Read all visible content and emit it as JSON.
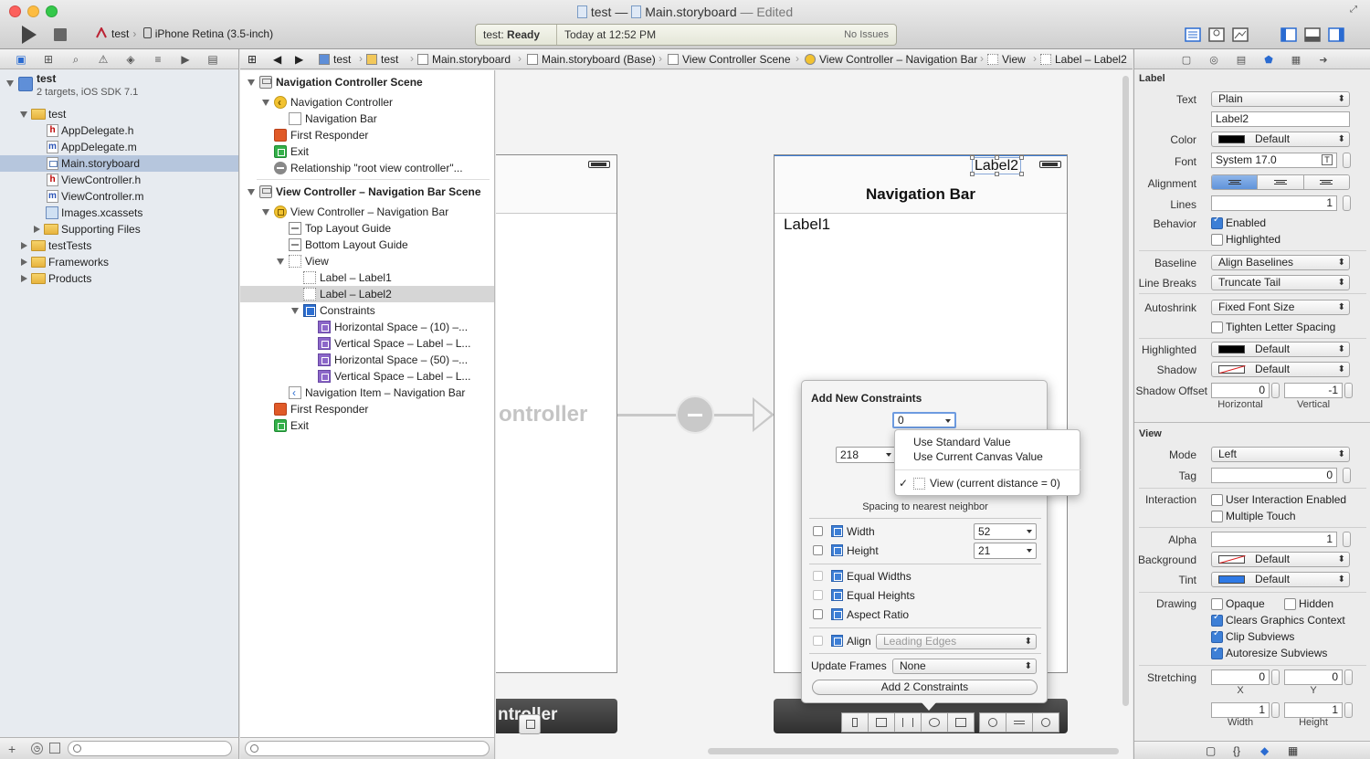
{
  "window": {
    "title_file": "test",
    "title_sep": "—",
    "title_doc": "Main.storyboard",
    "title_edited": "— Edited"
  },
  "toolbar": {
    "scheme": "test",
    "device": "iPhone Retina (3.5-inch)",
    "status_name": "test:",
    "status_state": "Ready",
    "status_time": "Today at 12:52 PM",
    "issues": "No Issues"
  },
  "navigator": {
    "project": {
      "name": "test",
      "subtitle": "2 targets, iOS SDK 7.1"
    },
    "items": [
      {
        "label": "test"
      },
      {
        "label": "AppDelegate.h"
      },
      {
        "label": "AppDelegate.m"
      },
      {
        "label": "Main.storyboard"
      },
      {
        "label": "ViewController.h"
      },
      {
        "label": "ViewController.m"
      },
      {
        "label": "Images.xcassets"
      },
      {
        "label": "Supporting Files"
      },
      {
        "label": "testTests"
      },
      {
        "label": "Frameworks"
      },
      {
        "label": "Products"
      }
    ]
  },
  "jumpbar": {
    "crumbs": [
      "test",
      "test",
      "Main.storyboard",
      "Main.storyboard (Base)",
      "View Controller Scene",
      "View Controller – Navigation Bar",
      "View",
      "Label – Label2"
    ]
  },
  "outline": {
    "rows": [
      "Navigation Controller Scene",
      "Navigation Controller",
      "Navigation Bar",
      "First Responder",
      "Exit",
      "Relationship \"root view controller\"...",
      "View Controller – Navigation Bar Scene",
      "View Controller – Navigation Bar",
      "Top Layout Guide",
      "Bottom Layout Guide",
      "View",
      "Label – Label1",
      "Label – Label2",
      "Constraints",
      "Horizontal Space – (10) –...",
      "Vertical Space – Label – L...",
      "Horizontal Space – (50) –...",
      "Vertical Space – Label – L...",
      "Navigation Item – Navigation Bar",
      "First Responder",
      "Exit"
    ]
  },
  "canvas": {
    "ghost_title": "ontroller",
    "ghost_dock": "ntroller",
    "nav_title": "Navigation Bar",
    "label1": "Label1",
    "label2": "Label2"
  },
  "popover": {
    "title": "Add New Constraints",
    "top_value": "0",
    "left_value": "218",
    "hint": "Spacing to nearest neighbor",
    "width_label": "Width",
    "width_value": "52",
    "height_label": "Height",
    "height_value": "21",
    "equal_widths": "Equal Widths",
    "equal_heights": "Equal Heights",
    "aspect_ratio": "Aspect Ratio",
    "align_label": "Align",
    "align_value": "Leading Edges",
    "update_frames_label": "Update Frames",
    "update_frames_value": "None",
    "add_button": "Add 2 Constraints"
  },
  "dropdown_menu": {
    "items": [
      "Use Standard Value",
      "Use Current Canvas Value",
      "View (current distance = 0)"
    ],
    "checkmark": "✓"
  },
  "inspector": {
    "label_section": "Label",
    "text_label": "Text",
    "text_value": "Plain",
    "text_content": "Label2",
    "color_label": "Color",
    "color_value": "Default",
    "font_label": "Font",
    "font_value": "System 17.0",
    "font_btn": "T",
    "alignment_label": "Alignment",
    "lines_label": "Lines",
    "lines_value": "1",
    "behavior_label": "Behavior",
    "enabled": "Enabled",
    "highlighted_cb": "Highlighted",
    "baseline_label": "Baseline",
    "baseline_value": "Align Baselines",
    "linebreaks_label": "Line Breaks",
    "linebreaks_value": "Truncate Tail",
    "autoshrink_label": "Autoshrink",
    "autoshrink_value": "Fixed Font Size",
    "tighten": "Tighten Letter Spacing",
    "highlighted_label": "Highlighted",
    "highlighted_value": "Default",
    "shadow_label": "Shadow",
    "shadow_value": "Default",
    "shadow_offset_label": "Shadow Offset",
    "shadow_h": "0",
    "shadow_v": "-1",
    "horizontal": "Horizontal",
    "vertical": "Vertical",
    "view_section": "View",
    "mode_label": "Mode",
    "mode_value": "Left",
    "tag_label": "Tag",
    "tag_value": "0",
    "interaction_label": "Interaction",
    "user_interaction": "User Interaction Enabled",
    "multiple_touch": "Multiple Touch",
    "alpha_label": "Alpha",
    "alpha_value": "1",
    "background_label": "Background",
    "background_value": "Default",
    "tint_label": "Tint",
    "tint_value": "Default",
    "drawing_label": "Drawing",
    "opaque": "Opaque",
    "hidden": "Hidden",
    "clears": "Clears Graphics Context",
    "clip": "Clip Subviews",
    "autoresize": "Autoresize Subviews",
    "stretching_label": "Stretching",
    "stretch_x": "0",
    "stretch_y": "0",
    "x_label": "X",
    "y_label": "Y",
    "stretch_w": "1",
    "stretch_h": "1",
    "width_label": "Width",
    "height_label": "Height",
    "bottom_icons": [
      "▢",
      "{}",
      "◆",
      "▦"
    ]
  },
  "colors": {
    "selection": "#b6c6dd",
    "accent": "#3d7fd6",
    "highlight": "#2a6bd1"
  }
}
